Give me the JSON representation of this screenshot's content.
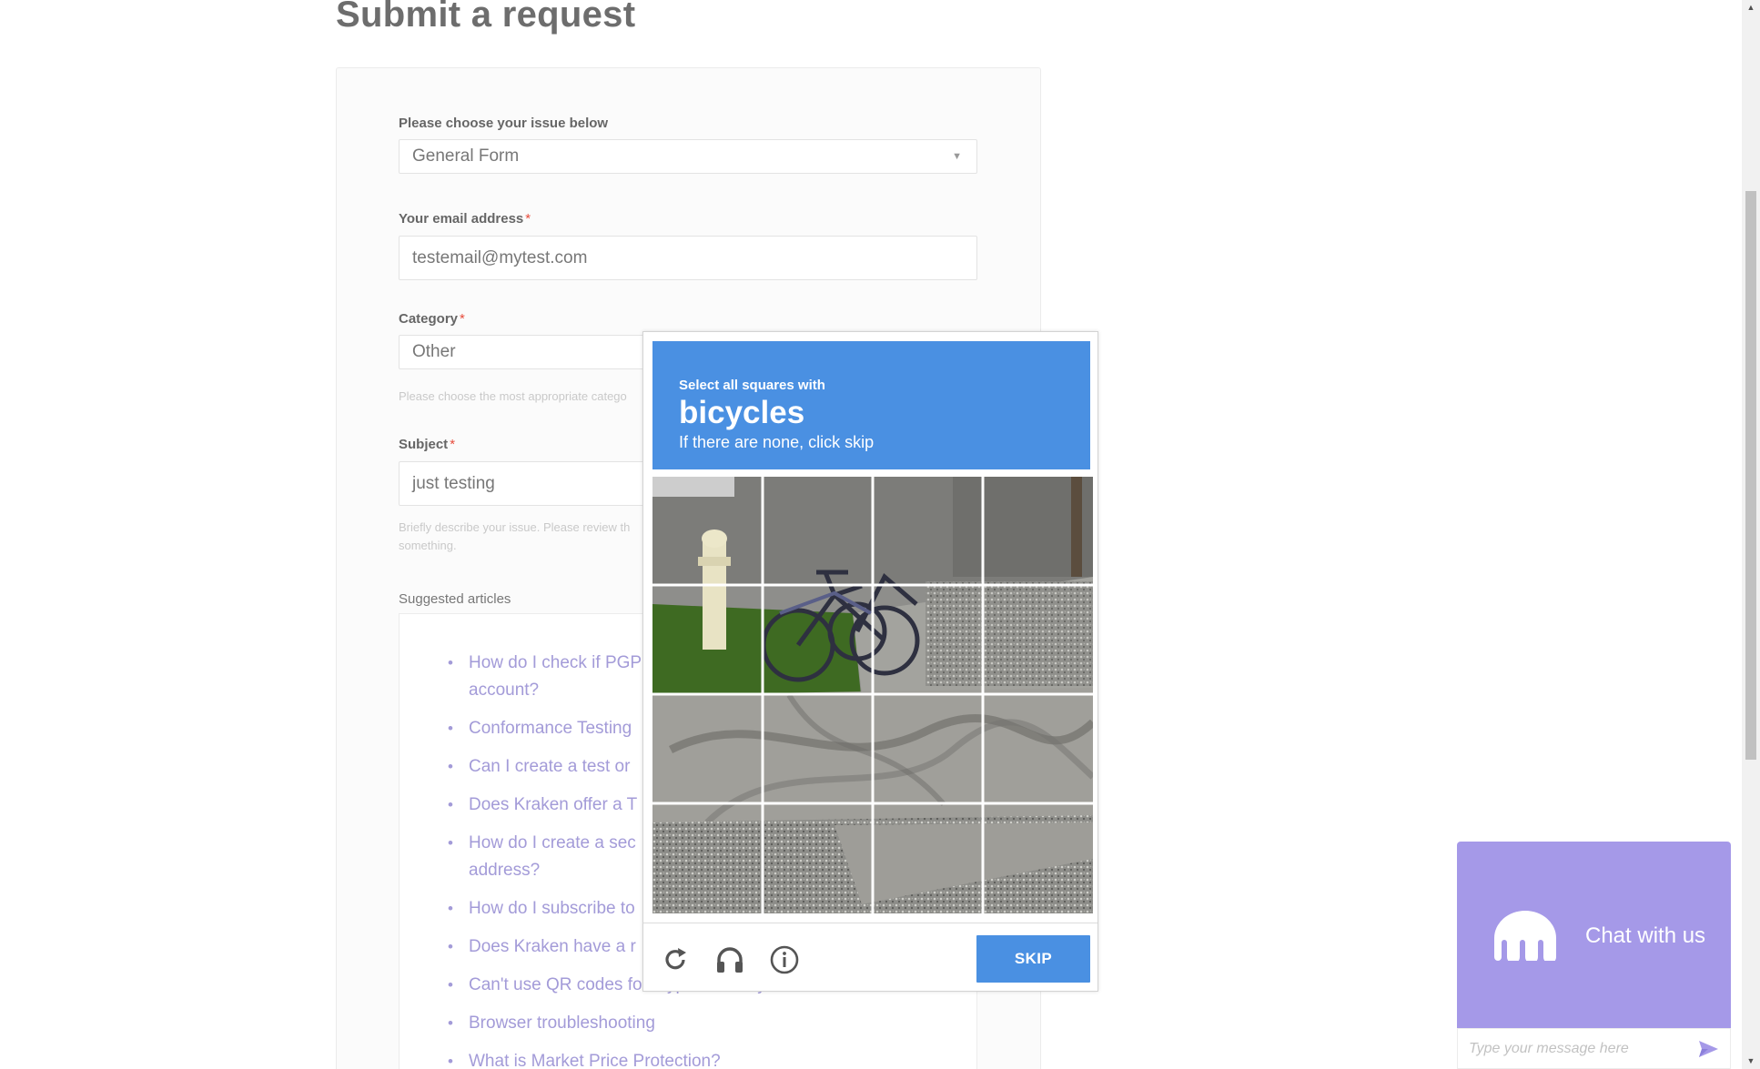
{
  "page": {
    "title": "Submit a request"
  },
  "form": {
    "issue": {
      "label": "Please choose your issue below",
      "value": "General Form"
    },
    "email": {
      "label": "Your email address",
      "required_mark": "*",
      "value": "testemail@mytest.com"
    },
    "category": {
      "label": "Category",
      "required_mark": "*",
      "value": "Other",
      "hint": "Please choose the most appropriate catego"
    },
    "subject": {
      "label": "Subject",
      "required_mark": "*",
      "value": "just testing",
      "hint_line1": "Briefly describe your issue. Please review th",
      "hint_line2": "something."
    },
    "suggested": {
      "label": "Suggested articles",
      "articles": [
        "How do I check if PGP",
        "account?",
        "Conformance Testing",
        "Can I create a test or",
        "Does Kraken offer a T",
        "How do I create a sec",
        "address?",
        "How do I subscribe to",
        "Does Kraken have a r",
        "Can't use QR codes for cryptocurrency withdrawals",
        "Browser troubleshooting",
        "What is Market Price Protection?"
      ]
    }
  },
  "captcha": {
    "instruction_small": "Select all squares with",
    "target": "bicycles",
    "instruction_sub": "If there are none, click skip",
    "skip_label": "SKIP",
    "icons": [
      "reload-icon",
      "headphones-icon",
      "info-icon"
    ],
    "accent_color": "#4a90e2",
    "tiles_selected": [
      false,
      false,
      false,
      false,
      false,
      false,
      false,
      false,
      false,
      false,
      false,
      false,
      false,
      false,
      false,
      false
    ]
  },
  "chat": {
    "title": "Chat with us",
    "input_placeholder": "Type your message here",
    "brand_color": "#a599e8"
  },
  "colors": {
    "link": "#a39bd8",
    "required": "#e74c3c"
  }
}
